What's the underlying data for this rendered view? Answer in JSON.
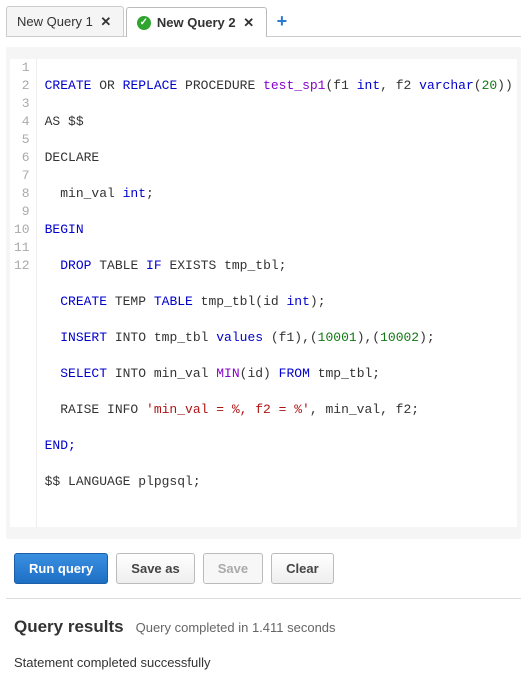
{
  "tabs": [
    {
      "label": "New Query 1",
      "active": false,
      "status": null
    },
    {
      "label": "New Query 2",
      "active": true,
      "status": "success"
    }
  ],
  "code_lines": 12,
  "code": {
    "l1_p1": "CREATE",
    "l1_p2": " OR ",
    "l1_p3": "REPLACE",
    "l1_p4": " PROCEDURE ",
    "l1_p5": "test_sp1",
    "l1_p6": "(f1 ",
    "l1_p7": "int",
    "l1_p8": ", f2 ",
    "l1_p9": "varchar",
    "l1_p10": "(",
    "l1_p11": "20",
    "l1_p12": "))",
    "l2": "AS $$",
    "l3": "DECLARE",
    "l4_p1": "  min_val ",
    "l4_p2": "int",
    "l4_p3": ";",
    "l5": "BEGIN",
    "l6_p1": "  ",
    "l6_p2": "DROP",
    "l6_p3": " TABLE ",
    "l6_p4": "IF",
    "l6_p5": " EXISTS tmp_tbl;",
    "l7_p1": "  ",
    "l7_p2": "CREATE",
    "l7_p3": " TEMP ",
    "l7_p4": "TABLE",
    "l7_p5": " tmp_tbl(id ",
    "l7_p6": "int",
    "l7_p7": ");",
    "l8_p1": "  ",
    "l8_p2": "INSERT",
    "l8_p3": " INTO tmp_tbl ",
    "l8_p4": "values",
    "l8_p5": " (f1),(",
    "l8_p6": "10001",
    "l8_p7": "),(",
    "l8_p8": "10002",
    "l8_p9": ");",
    "l9_p1": "  ",
    "l9_p2": "SELECT",
    "l9_p3": " INTO min_val ",
    "l9_p4": "MIN",
    "l9_p5": "(id) ",
    "l9_p6": "FROM",
    "l9_p7": " tmp_tbl;",
    "l10_p1": "  RAISE INFO ",
    "l10_p2": "'min_val = %, f2 = %'",
    "l10_p3": ", min_val, f2;",
    "l11": "END;",
    "l12": "$$ LANGUAGE plpgsql;"
  },
  "toolbar": {
    "run": "Run query",
    "save_as": "Save as",
    "save": "Save",
    "clear": "Clear"
  },
  "results": {
    "title": "Query results",
    "time": "Query completed in 1.411 seconds",
    "message": "Statement completed successfully"
  },
  "icons": {
    "success_check": "✓",
    "close": "✕",
    "plus": "+"
  },
  "colors": {
    "success": "#2fa52f",
    "primary": "#2a7ad2"
  }
}
